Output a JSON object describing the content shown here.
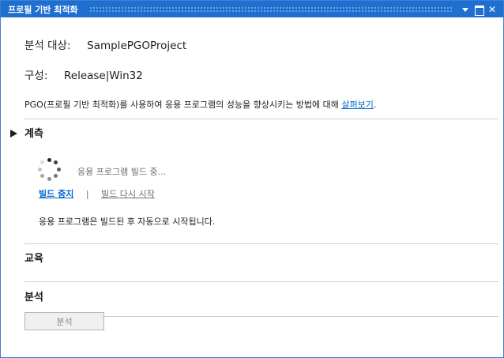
{
  "window": {
    "title": "프로필 기반 최적화",
    "controls": [
      "dropdown-icon",
      "maximize-icon",
      "close-icon"
    ]
  },
  "header": {
    "target_label": "분석 대상:",
    "target_value": "SamplePGOProject",
    "config_label": "구성:",
    "config_value": "Release|Win32",
    "info_text": "PGO(프로필 기반 최적화)를 사용하여 응용 프로그램의 성능을 향상시키는 방법에 대해 ",
    "info_link": "살펴보기",
    "info_end": "."
  },
  "measure": {
    "title": "계측",
    "status": "응용 프로그램 빌드 중...",
    "stop_link": "빌드 중지",
    "separator": "|",
    "restart_link": "빌드 다시 시작",
    "note": "응용 프로그램은 빌드된 후 자동으로 시작됩니다."
  },
  "sections": {
    "training": "교육",
    "analysis": "분석"
  },
  "footer": {
    "analyze_button": "분석"
  },
  "colors": {
    "titlebar": "#1f6fd0",
    "link": "#0066cc"
  }
}
